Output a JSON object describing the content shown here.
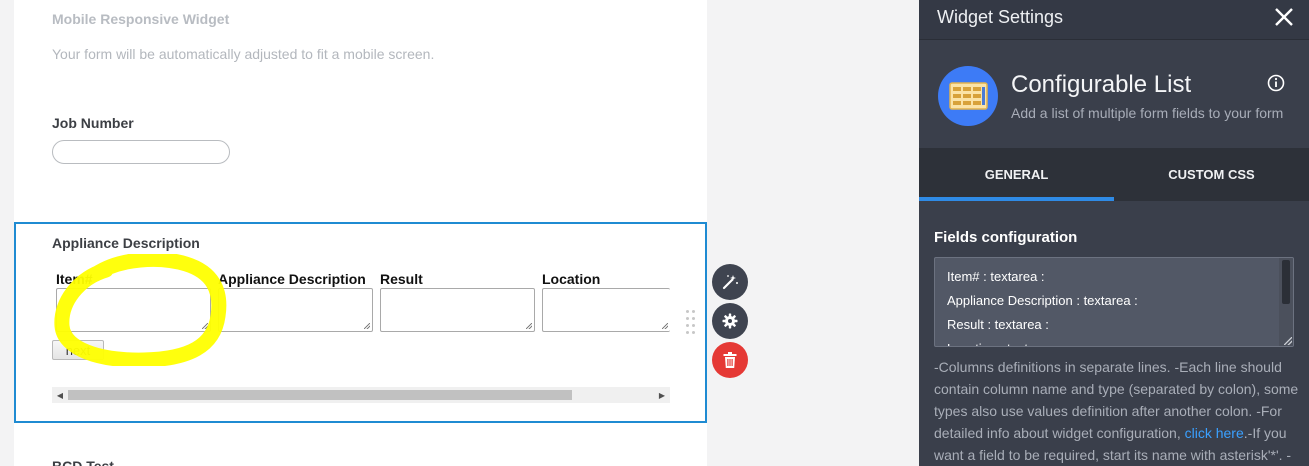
{
  "form": {
    "responsive_title": "Mobile Responsive Widget",
    "responsive_subtitle": "Your form will be automatically adjusted to fit a mobile screen.",
    "job_number_label": "Job Number",
    "job_number_value": "",
    "appliance_label": "Appliance Description",
    "columns": [
      "Item#",
      "Appliance Description",
      "Result",
      "Location"
    ],
    "next_button": "next",
    "partial_next_label": "BCD Test"
  },
  "colors": {
    "selection_border": "#1f8bd2",
    "highlight": "#ffff00",
    "delete_button": "#e53935",
    "panel_bg": "#3a3f4b",
    "accent_blue": "#2f8be6"
  },
  "toolbar": {
    "icons": [
      "magic-wand-icon",
      "gear-icon",
      "trash-icon"
    ]
  },
  "panel": {
    "title": "Widget Settings",
    "widget_name": "Configurable List",
    "widget_desc": "Add a list of multiple form fields to your form",
    "tabs": [
      "GENERAL",
      "CUSTOM CSS"
    ],
    "active_tab": "GENERAL",
    "fields_title": "Fields configuration",
    "fields_lines": [
      "Item# : textarea :",
      "Appliance Description : textarea :",
      "Result : textarea :",
      "Location : textarea :"
    ],
    "help_part1": "-Columns definitions in separate lines. -Each line should contain column name and type (separated by colon), some types also use values definition after another colon. -For detailed info about widget configuration, ",
    "help_link": "click here",
    "help_part2": ".-If you want a field to be required, start its name with asterisk'*'. -"
  }
}
